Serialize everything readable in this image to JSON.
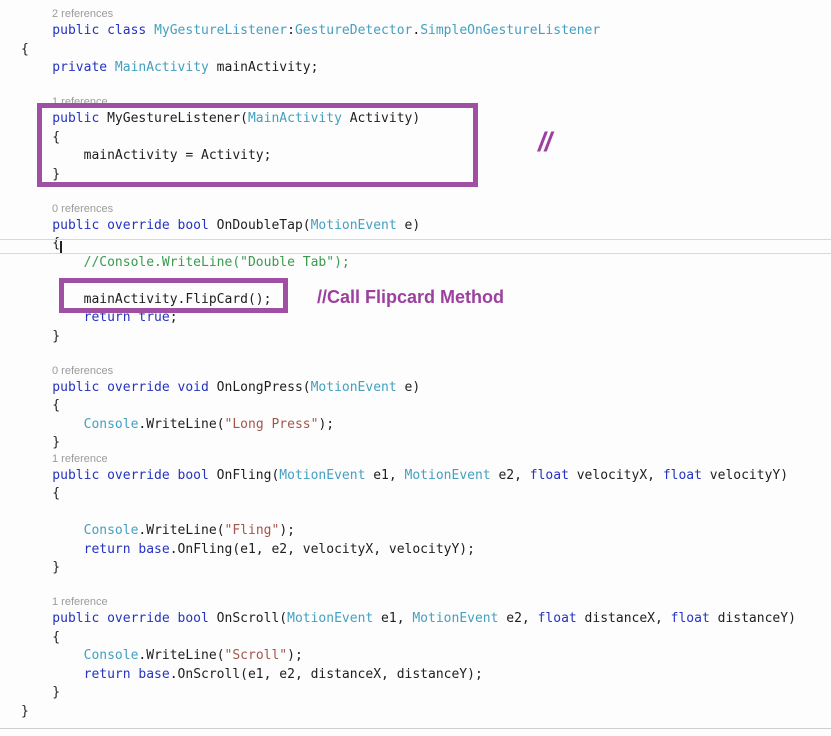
{
  "colors": {
    "keyword": "#2433c0",
    "type": "#44a0c0",
    "plain": "#1e1e1e",
    "comment": "#3a9b4f",
    "string": "#a5544b",
    "reference_label": "#9b9b9b",
    "annotation_purple": "#9c3f9e",
    "annotation_box_purple": "#a050a2",
    "background": "#fdfdfd"
  },
  "annotations": {
    "slashes": "//",
    "callout": "//Call Flipcard Method"
  },
  "editor": {
    "lines": [
      {
        "kind": "ref",
        "text": "2 references"
      },
      {
        "kind": "code",
        "segments": [
          [
            "kw",
            "    public class "
          ],
          [
            "type",
            "MyGestureListener"
          ],
          [
            "plain",
            ":"
          ],
          [
            "type",
            "GestureDetector"
          ],
          [
            "plain",
            "."
          ],
          [
            "type",
            "SimpleOnGestureListener"
          ]
        ]
      },
      {
        "kind": "code",
        "segments": [
          [
            "plain",
            "{"
          ]
        ]
      },
      {
        "kind": "code",
        "segments": [
          [
            "kw",
            "    private "
          ],
          [
            "type",
            "MainActivity"
          ],
          [
            "plain",
            " mainActivity;"
          ]
        ]
      },
      {
        "kind": "blank"
      },
      {
        "kind": "ref",
        "text": "1 reference"
      },
      {
        "kind": "code",
        "segments": [
          [
            "kw",
            "    public "
          ],
          [
            "plain",
            "MyGestureListener("
          ],
          [
            "type",
            "MainActivity"
          ],
          [
            "plain",
            " Activity)"
          ]
        ]
      },
      {
        "kind": "code",
        "segments": [
          [
            "plain",
            "    {"
          ]
        ]
      },
      {
        "kind": "code",
        "segments": [
          [
            "plain",
            "        mainActivity = Activity;"
          ]
        ]
      },
      {
        "kind": "code",
        "segments": [
          [
            "plain",
            "    }"
          ]
        ]
      },
      {
        "kind": "blank"
      },
      {
        "kind": "ref",
        "text": "0 references"
      },
      {
        "kind": "code",
        "segments": [
          [
            "kw",
            "    public override bool "
          ],
          [
            "plain",
            "OnDoubleTap("
          ],
          [
            "type",
            "MotionEvent"
          ],
          [
            "plain",
            " e)"
          ]
        ]
      },
      {
        "kind": "code",
        "segments": [
          [
            "plain",
            "    {"
          ]
        ]
      },
      {
        "kind": "code",
        "segments": [
          [
            "cm",
            "        //Console.WriteLine(\"Double Tab\");"
          ]
        ]
      },
      {
        "kind": "blank"
      },
      {
        "kind": "code",
        "segments": [
          [
            "plain",
            "        mainActivity.FlipCard();"
          ]
        ]
      },
      {
        "kind": "code",
        "segments": [
          [
            "kw",
            "        return true"
          ],
          [
            "plain",
            ";"
          ]
        ]
      },
      {
        "kind": "code",
        "segments": [
          [
            "plain",
            "    }"
          ]
        ]
      },
      {
        "kind": "blank"
      },
      {
        "kind": "ref",
        "text": "0 references"
      },
      {
        "kind": "code",
        "segments": [
          [
            "kw",
            "    public override void "
          ],
          [
            "plain",
            "OnLongPress("
          ],
          [
            "type",
            "MotionEvent"
          ],
          [
            "plain",
            " e)"
          ]
        ]
      },
      {
        "kind": "code",
        "segments": [
          [
            "plain",
            "    {"
          ]
        ]
      },
      {
        "kind": "code",
        "segments": [
          [
            "plain",
            "        "
          ],
          [
            "type",
            "Console"
          ],
          [
            "plain",
            ".WriteLine("
          ],
          [
            "str",
            "\"Long Press\""
          ],
          [
            "plain",
            ");"
          ]
        ]
      },
      {
        "kind": "code",
        "segments": [
          [
            "plain",
            "    }"
          ]
        ]
      },
      {
        "kind": "ref",
        "text": "1 reference"
      },
      {
        "kind": "code",
        "segments": [
          [
            "kw",
            "    public override bool "
          ],
          [
            "plain",
            "OnFling("
          ],
          [
            "type",
            "MotionEvent"
          ],
          [
            "plain",
            " e1, "
          ],
          [
            "type",
            "MotionEvent"
          ],
          [
            "plain",
            " e2, "
          ],
          [
            "kw",
            "float"
          ],
          [
            "plain",
            " velocityX, "
          ],
          [
            "kw",
            "float"
          ],
          [
            "plain",
            " velocityY)"
          ]
        ]
      },
      {
        "kind": "code",
        "segments": [
          [
            "plain",
            "    {"
          ]
        ]
      },
      {
        "kind": "blank"
      },
      {
        "kind": "code",
        "segments": [
          [
            "plain",
            "        "
          ],
          [
            "type",
            "Console"
          ],
          [
            "plain",
            ".WriteLine("
          ],
          [
            "str",
            "\"Fling\""
          ],
          [
            "plain",
            ");"
          ]
        ]
      },
      {
        "kind": "code",
        "segments": [
          [
            "kw",
            "        return base"
          ],
          [
            "plain",
            ".OnFling(e1, e2, velocityX, velocityY);"
          ]
        ]
      },
      {
        "kind": "code",
        "segments": [
          [
            "plain",
            "    }"
          ]
        ]
      },
      {
        "kind": "blank"
      },
      {
        "kind": "ref",
        "text": "1 reference"
      },
      {
        "kind": "code",
        "segments": [
          [
            "kw",
            "    public override bool "
          ],
          [
            "plain",
            "OnScroll("
          ],
          [
            "type",
            "MotionEvent"
          ],
          [
            "plain",
            " e1, "
          ],
          [
            "type",
            "MotionEvent"
          ],
          [
            "plain",
            " e2, "
          ],
          [
            "kw",
            "float"
          ],
          [
            "plain",
            " distanceX, "
          ],
          [
            "kw",
            "float"
          ],
          [
            "plain",
            " distanceY)"
          ]
        ]
      },
      {
        "kind": "code",
        "segments": [
          [
            "plain",
            "    {"
          ]
        ]
      },
      {
        "kind": "code",
        "segments": [
          [
            "plain",
            "        "
          ],
          [
            "type",
            "Console"
          ],
          [
            "plain",
            ".WriteLine("
          ],
          [
            "str",
            "\"Scroll\""
          ],
          [
            "plain",
            ");"
          ]
        ]
      },
      {
        "kind": "code",
        "segments": [
          [
            "kw",
            "        return base"
          ],
          [
            "plain",
            ".OnScroll(e1, e2, distanceX, distanceY);"
          ]
        ]
      },
      {
        "kind": "code",
        "segments": [
          [
            "plain",
            "    }"
          ]
        ]
      },
      {
        "kind": "code",
        "segments": [
          [
            "plain",
            "}"
          ]
        ]
      }
    ]
  }
}
